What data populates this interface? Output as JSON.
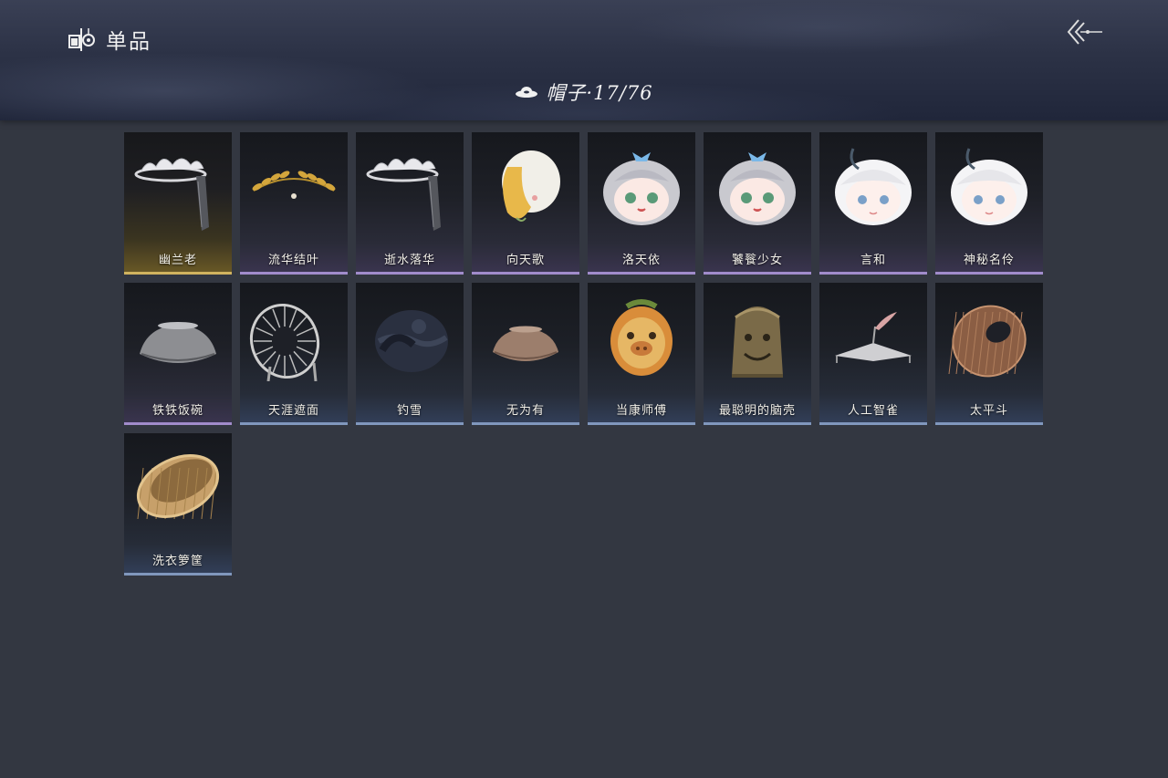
{
  "header": {
    "title": "单品",
    "title_icon": "wardrobe-icon",
    "back_icon": "back-arrow-icon"
  },
  "category": {
    "icon": "hat-icon",
    "label": "帽子·17/76"
  },
  "items": [
    {
      "name": "幽兰老",
      "rarity": "gold",
      "art": "silver-tiara"
    },
    {
      "name": "流华结叶",
      "rarity": "purple",
      "art": "gold-laurel"
    },
    {
      "name": "逝水落华",
      "rarity": "purple",
      "art": "silver-tiara"
    },
    {
      "name": "向天歌",
      "rarity": "purple",
      "art": "goose-hood"
    },
    {
      "name": "洛天依",
      "rarity": "purple",
      "art": "grey-head"
    },
    {
      "name": "饕餮少女",
      "rarity": "purple",
      "art": "grey-head"
    },
    {
      "name": "言和",
      "rarity": "purple",
      "art": "white-head"
    },
    {
      "name": "神秘名伶",
      "rarity": "purple",
      "art": "white-head"
    },
    {
      "name": "铁铁饭碗",
      "rarity": "purple",
      "art": "iron-bowl"
    },
    {
      "name": "天涯遮面",
      "rarity": "blue",
      "art": "frame-hat"
    },
    {
      "name": "钓雪",
      "rarity": "blue",
      "art": "cloth-hat"
    },
    {
      "name": "无为有",
      "rarity": "blue",
      "art": "clay-bowl"
    },
    {
      "name": "当康师傅",
      "rarity": "blue",
      "art": "pig-head"
    },
    {
      "name": "最聪明的脑壳",
      "rarity": "blue",
      "art": "bell-head"
    },
    {
      "name": "人工智雀",
      "rarity": "blue",
      "art": "bird-hat"
    },
    {
      "name": "太平斗",
      "rarity": "blue",
      "art": "woven-hat"
    },
    {
      "name": "洗衣箩筐",
      "rarity": "blue",
      "art": "basket"
    }
  ],
  "colors": {
    "background": "#333741",
    "rarity_gold": "#e3c36a",
    "rarity_purple": "#b49be0",
    "rarity_blue": "#8ea7cf"
  }
}
